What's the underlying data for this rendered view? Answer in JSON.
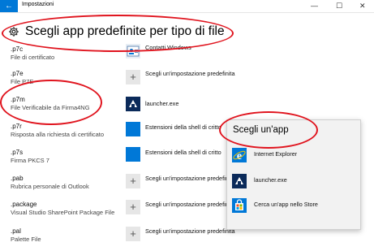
{
  "window": {
    "title": "Impostazioni",
    "back_glyph": "←",
    "minimize_glyph": "—",
    "maximize_glyph": "☐",
    "close_glyph": "✕"
  },
  "header": {
    "title": "Scegli app predefinite per tipo di file"
  },
  "file_types": [
    {
      "ext": ".p7c",
      "desc": "File di certificato",
      "app": "Contatti Windows",
      "icon": "contacts-icon"
    },
    {
      "ext": ".p7e",
      "desc": "File P7E",
      "app": "Scegli un'impostazione predefinita",
      "icon": "plus-icon"
    },
    {
      "ext": ".p7m",
      "desc": "File Verificabile da Firma4NG",
      "app": "launcher.exe",
      "icon": "launcher-icon"
    },
    {
      "ext": ".p7r",
      "desc": "Risposta alla richiesta di certificato",
      "app": "Estensioni della shell di critto",
      "icon": "shell-extension-icon"
    },
    {
      "ext": ".p7s",
      "desc": "Firma PKCS 7",
      "app": "Estensioni della shell di critto",
      "icon": "shell-extension-icon"
    },
    {
      "ext": ".pab",
      "desc": "Rubrica personale di Outlook",
      "app": "Scegli un'impostazione predefinita",
      "icon": "plus-icon"
    },
    {
      "ext": ".package",
      "desc": "Visual Studio SharePoint Package File",
      "app": "Scegli un'impostazione predefinita",
      "icon": "plus-icon"
    },
    {
      "ext": ".pal",
      "desc": "Palette File",
      "app": "Scegli un'impostazione predefinita",
      "icon": "plus-icon"
    }
  ],
  "popup": {
    "title": "Scegli un'app",
    "items": [
      {
        "label": "Internet Explorer",
        "icon": "internet-explorer-icon"
      },
      {
        "label": "launcher.exe",
        "icon": "launcher-icon"
      },
      {
        "label": "Cerca un'app nello Store",
        "icon": "store-icon"
      }
    ]
  },
  "colors": {
    "accent": "#0078d7",
    "annotation": "#e0141e",
    "popup_bg": "#f2f2f2"
  }
}
